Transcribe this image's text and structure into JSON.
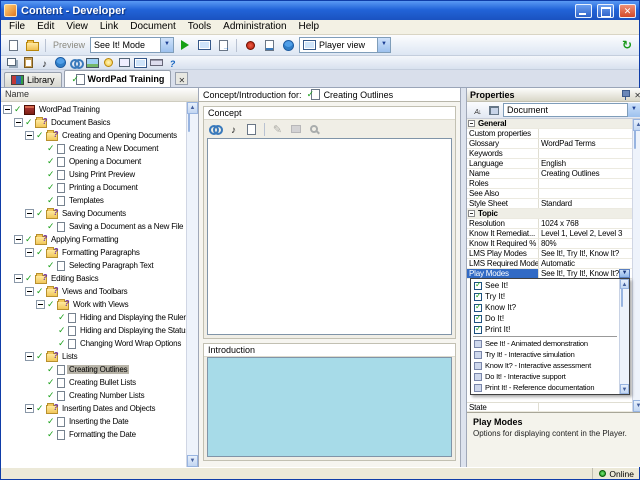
{
  "window": {
    "title": "Content - Developer"
  },
  "menubar": {
    "items": [
      "File",
      "Edit",
      "View",
      "Link",
      "Document",
      "Tools",
      "Administration",
      "Help"
    ]
  },
  "toolbar": {
    "group1": [
      "new-document",
      "open"
    ],
    "preview_label": "Preview",
    "mode_combo": "See It! Mode",
    "group2": [
      "play",
      "preview-player",
      "export"
    ],
    "group3": [
      "record",
      "document-link",
      "web"
    ],
    "player_combo": "Player view",
    "group4": [
      "refresh"
    ],
    "row2": [
      "cascade-windows",
      "paste",
      "sound",
      "web",
      "link",
      "image",
      "bulb",
      "frame",
      "monitor",
      "keyboard",
      "help"
    ]
  },
  "tabs": [
    {
      "label": "Library",
      "active": false
    },
    {
      "label": "WordPad Training",
      "active": true
    }
  ],
  "tree": {
    "column_header": "Name",
    "items": [
      {
        "label": "WordPad Training",
        "depth": 0,
        "type": "module",
        "expandable": true
      },
      {
        "label": "Document Basics",
        "depth": 1,
        "type": "section",
        "expandable": true
      },
      {
        "label": "Creating and Opening Documents",
        "depth": 2,
        "type": "section",
        "expandable": true
      },
      {
        "label": "Creating a New Document",
        "depth": 3,
        "type": "topic",
        "expandable": false
      },
      {
        "label": "Opening a Document",
        "depth": 3,
        "type": "topic",
        "expandable": false
      },
      {
        "label": "Using Print Preview",
        "depth": 3,
        "type": "topic",
        "expandable": false
      },
      {
        "label": "Printing a Document",
        "depth": 3,
        "type": "topic",
        "expandable": false
      },
      {
        "label": "Templates",
        "depth": 3,
        "type": "topic",
        "expandable": false
      },
      {
        "label": "Saving Documents",
        "depth": 2,
        "type": "section",
        "expandable": true
      },
      {
        "label": "Saving a Document as a New File",
        "depth": 3,
        "type": "topic",
        "expandable": false
      },
      {
        "label": "Applying Formatting",
        "depth": 1,
        "type": "section",
        "expandable": true
      },
      {
        "label": "Formatting Paragraphs",
        "depth": 2,
        "type": "section",
        "expandable": true
      },
      {
        "label": "Selecting Paragraph Text",
        "depth": 3,
        "type": "topic",
        "expandable": false
      },
      {
        "label": "Editing Basics",
        "depth": 1,
        "type": "section",
        "expandable": true
      },
      {
        "label": "Views and Toolbars",
        "depth": 2,
        "type": "section",
        "expandable": true
      },
      {
        "label": "Work with Views",
        "depth": 3,
        "type": "section",
        "expandable": true
      },
      {
        "label": "Hiding and Displaying the Ruler",
        "depth": 4,
        "type": "topic",
        "expandable": false
      },
      {
        "label": "Hiding and Displaying the Status Bar",
        "depth": 4,
        "type": "topic",
        "expandable": false
      },
      {
        "label": "Changing Word Wrap Options",
        "depth": 4,
        "type": "topic",
        "expandable": false
      },
      {
        "label": "Lists",
        "depth": 2,
        "type": "section",
        "expandable": true
      },
      {
        "label": "Creating Outlines",
        "depth": 3,
        "type": "topic",
        "expandable": false,
        "selected": true
      },
      {
        "label": "Creating Bullet Lists",
        "depth": 3,
        "type": "topic",
        "expandable": false
      },
      {
        "label": "Creating Number Lists",
        "depth": 3,
        "type": "topic",
        "expandable": false
      },
      {
        "label": "Inserting Dates and Objects",
        "depth": 2,
        "type": "section",
        "expandable": true
      },
      {
        "label": "Inserting the Date",
        "depth": 3,
        "type": "topic",
        "expandable": false
      },
      {
        "label": "Formatting the Date",
        "depth": 3,
        "type": "topic",
        "expandable": false
      }
    ]
  },
  "editor": {
    "header_label": "Concept/Introduction for:",
    "header_doc": "Creating Outlines",
    "concept_label": "Concept",
    "introduction_label": "Introduction",
    "toolbar_icons": [
      "link",
      "sound",
      "document"
    ],
    "toolbar_icons_disabled": [
      "pencil",
      "stamp",
      "zoom"
    ]
  },
  "properties": {
    "title": "Properties",
    "toolbar_icons": [
      "sort-alpha",
      "categorize"
    ],
    "type_combo": "Document",
    "rows": [
      {
        "kind": "section",
        "label": "General"
      },
      {
        "kind": "row",
        "label": "Custom properties",
        "value": ""
      },
      {
        "kind": "row",
        "label": "Glossary",
        "value": "WordPad Terms"
      },
      {
        "kind": "row",
        "label": "Keywords",
        "value": ""
      },
      {
        "kind": "row",
        "label": "Language",
        "value": "English"
      },
      {
        "kind": "row",
        "label": "Name",
        "value": "Creating Outlines"
      },
      {
        "kind": "row",
        "label": "Roles",
        "value": ""
      },
      {
        "kind": "row",
        "label": "See Also",
        "value": ""
      },
      {
        "kind": "row",
        "label": "Style Sheet",
        "value": "Standard"
      },
      {
        "kind": "section",
        "label": "Topic"
      },
      {
        "kind": "row",
        "label": "Resolution",
        "value": "1024 x 768"
      },
      {
        "kind": "row",
        "label": "Know It Remediat...",
        "value": "Level 1, Level 2, Level 3"
      },
      {
        "kind": "row",
        "label": "Know It Required %",
        "value": "80%"
      },
      {
        "kind": "row",
        "label": "LMS Play Modes",
        "value": "See It!, Try It!, Know It?"
      },
      {
        "kind": "row",
        "label": "LMS Required Mode",
        "value": "Automatic"
      },
      {
        "kind": "row",
        "label": "Play Modes",
        "value": "See It!, Try It!, Know It?",
        "selected": true
      }
    ],
    "bottom_row": {
      "label": "State",
      "value": ""
    },
    "dropdown": {
      "options": [
        {
          "label": "See It!",
          "checked": true
        },
        {
          "label": "Try It!",
          "checked": true
        },
        {
          "label": "Know It?",
          "checked": true
        },
        {
          "label": "Do It!",
          "checked": true
        },
        {
          "label": "Print It!",
          "checked": true
        }
      ],
      "legend": [
        "See It! - Animated demonstration",
        "Try It! - Interactive simulation",
        "Know It? - Interactive assessment",
        "Do It! - Interactive support",
        "Print It! - Reference documentation"
      ]
    },
    "description": {
      "title": "Play Modes",
      "text": "Options for displaying content in the Player."
    }
  },
  "statusbar": {
    "online_label": "Online"
  },
  "colors": {
    "accent_blue": "#316ac5",
    "check_green": "#1ba01b",
    "introduction_bg": "#a7dbe8",
    "online_green": "#128a12"
  }
}
